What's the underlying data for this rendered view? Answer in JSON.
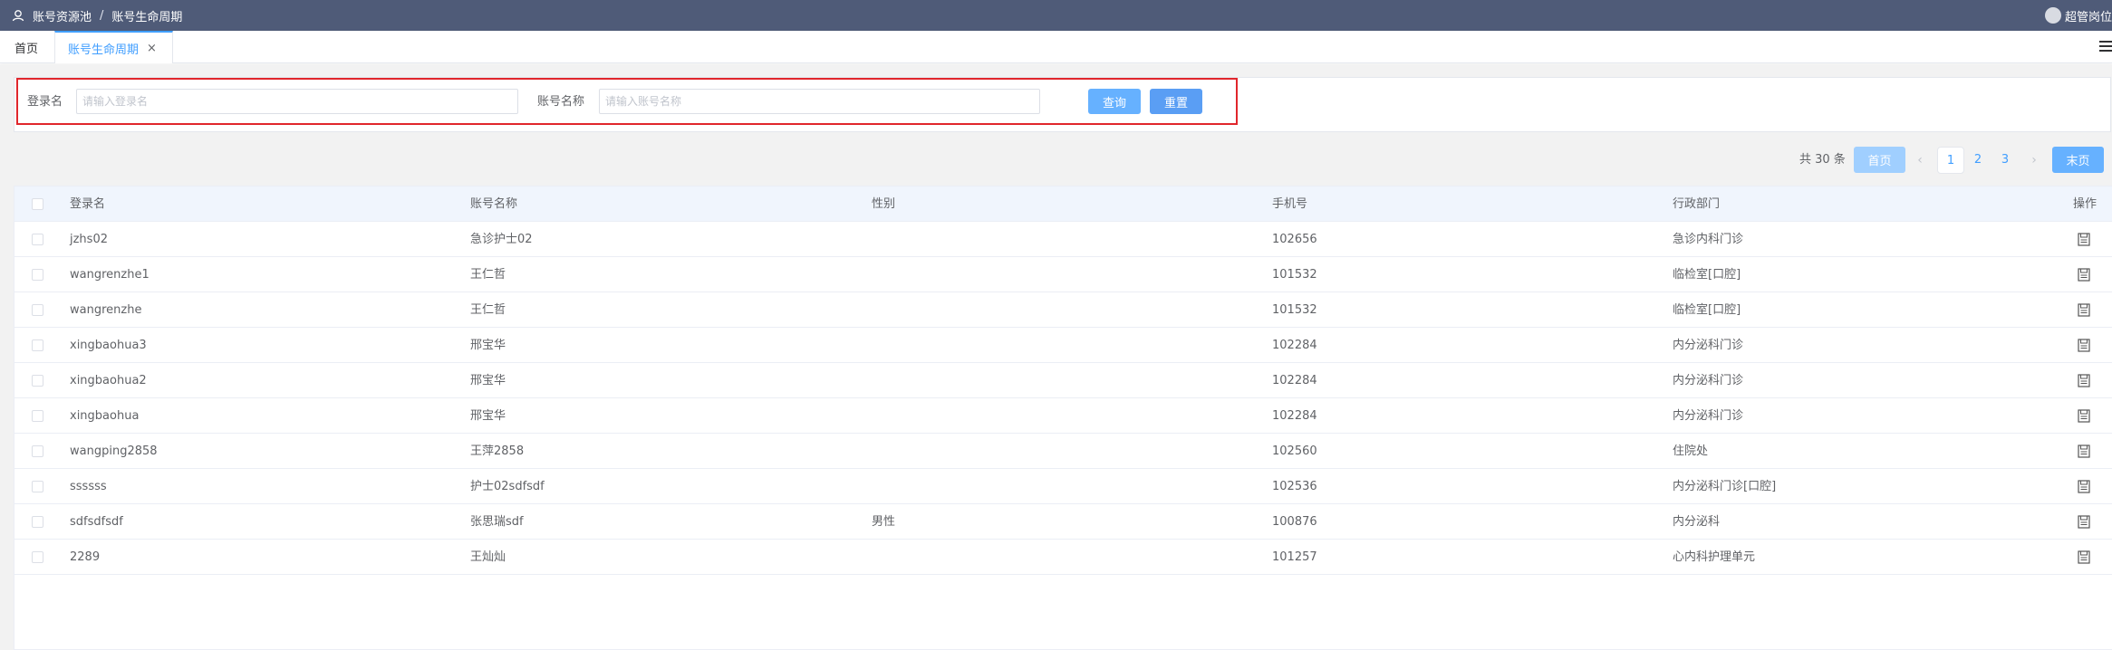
{
  "header": {
    "breadcrumb": [
      "账号资源池",
      "账号生命周期"
    ],
    "separator": "/",
    "user_name": "超管岗位"
  },
  "tabs": {
    "home": "首页",
    "active": "账号生命周期",
    "close": "×"
  },
  "search": {
    "login_label": "登录名",
    "login_placeholder": "请输入登录名",
    "login_value": "",
    "account_label": "账号名称",
    "account_placeholder": "请输入账号名称",
    "account_value": "",
    "query_button": "查询",
    "reset_button": "重置"
  },
  "pager": {
    "total": "共 30 条",
    "first": "首页",
    "prev": "‹",
    "pages": [
      "1",
      "2",
      "3"
    ],
    "current": "1",
    "next": "›",
    "last": "末页"
  },
  "table": {
    "columns": [
      "登录名",
      "账号名称",
      "性别",
      "手机号",
      "行政部门",
      "操作"
    ],
    "rows": [
      {
        "login": "jzhs02",
        "name": "急诊护士02",
        "gender": "",
        "phone": "102656",
        "dept": "急诊内科门诊"
      },
      {
        "login": "wangrenzhe1",
        "name": "王仁哲",
        "gender": "",
        "phone": "101532",
        "dept": "临检室[口腔]"
      },
      {
        "login": "wangrenzhe",
        "name": "王仁哲",
        "gender": "",
        "phone": "101532",
        "dept": "临检室[口腔]"
      },
      {
        "login": "xingbaohua3",
        "name": "邢宝华",
        "gender": "",
        "phone": "102284",
        "dept": "内分泌科门诊"
      },
      {
        "login": "xingbaohua2",
        "name": "邢宝华",
        "gender": "",
        "phone": "102284",
        "dept": "内分泌科门诊"
      },
      {
        "login": "xingbaohua",
        "name": "邢宝华",
        "gender": "",
        "phone": "102284",
        "dept": "内分泌科门诊"
      },
      {
        "login": "wangping2858",
        "name": "王萍2858",
        "gender": "",
        "phone": "102560",
        "dept": "住院处"
      },
      {
        "login": "ssssss",
        "name": "护士02sdfsdf",
        "gender": "",
        "phone": "102536",
        "dept": "内分泌科门诊[口腔]"
      },
      {
        "login": "sdfsdfsdf",
        "name": "张思瑞sdf",
        "gender": "男性",
        "phone": "100876",
        "dept": "内分泌科"
      },
      {
        "login": "2289",
        "name": "王灿灿",
        "gender": "",
        "phone": "101257",
        "dept": "心内科护理单元"
      }
    ]
  },
  "colors": {
    "header_bg": "#4f5b78",
    "accent": "#409eff",
    "highlight_border": "#e0262c"
  },
  "icons": {
    "pool": "user-pool-icon",
    "avatar": "avatar",
    "menu": "hamburger-menu-icon",
    "edit": "edit-record-icon"
  }
}
